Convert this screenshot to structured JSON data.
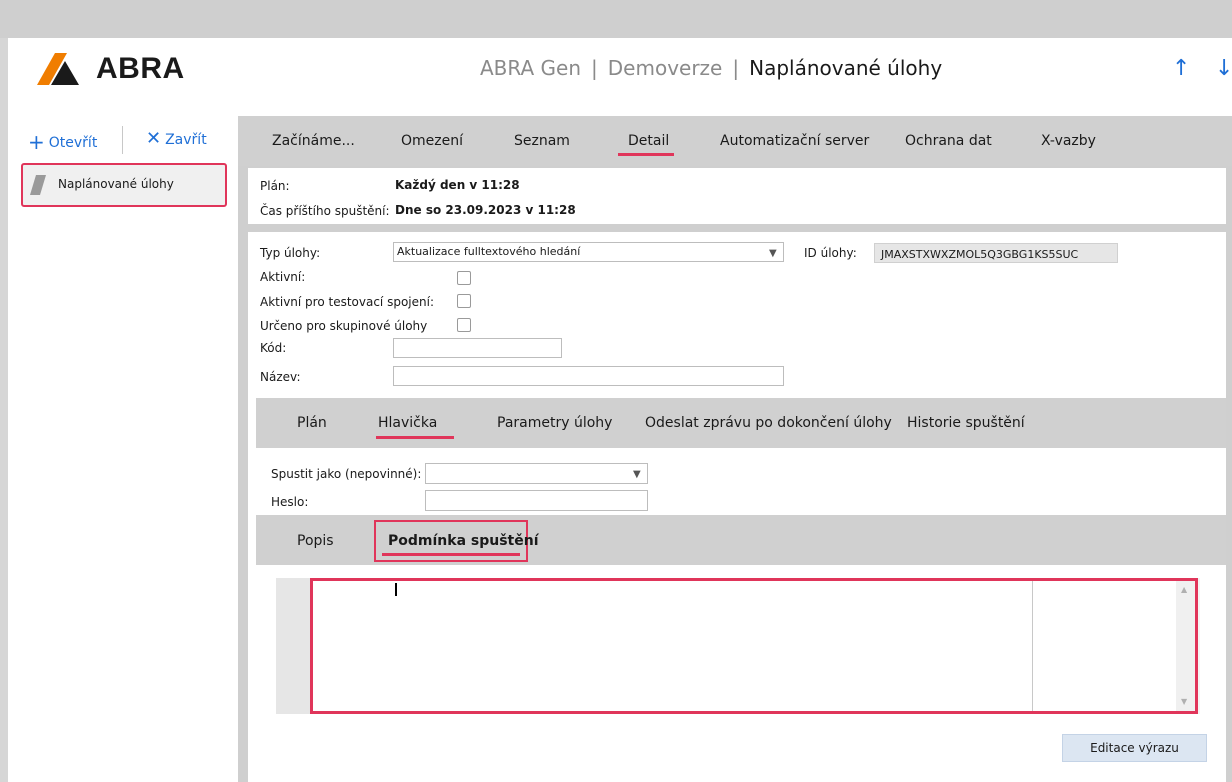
{
  "brand": {
    "logo_text": "ABRA"
  },
  "title": {
    "app": "ABRA Gen",
    "edition": "Demoverze",
    "module": "Naplánované úlohy"
  },
  "nav": {
    "up_icon": "arrow-up-icon",
    "down_icon": "arrow-down-icon"
  },
  "sidebar": {
    "open_label": "Otevřít",
    "close_label": "Zavřít",
    "items": [
      {
        "label": "Naplánované úlohy"
      }
    ]
  },
  "tabs": [
    {
      "label": "Začínáme..."
    },
    {
      "label": "Omezení"
    },
    {
      "label": "Seznam"
    },
    {
      "label": "Detail",
      "active": true
    },
    {
      "label": "Automatizační server"
    },
    {
      "label": "Ochrana dat"
    },
    {
      "label": "X-vazby"
    }
  ],
  "info": {
    "plan_label": "Plán:",
    "plan_value": "Každý den v 11:28",
    "next_label": "Čas příštího spuštění:",
    "next_value": "Dne so 23.09.2023 v 11:28"
  },
  "form": {
    "type_label": "Typ úlohy:",
    "type_value": "Aktualizace fulltextového hledání",
    "id_label": "ID úlohy:",
    "id_value": "JMAXSTXWXZMOL5Q3GBG1KS5SUC",
    "active_label": "Aktivní:",
    "active_test_label": "Aktivní pro testovací spojení:",
    "group_label": "Určeno pro skupinové úlohy",
    "code_label": "Kód:",
    "name_label": "Název:"
  },
  "subtabs": [
    {
      "label": "Plán"
    },
    {
      "label": "Hlavička",
      "active": true
    },
    {
      "label": "Parametry úlohy"
    },
    {
      "label": "Odeslat zprávu po dokončení úlohy"
    },
    {
      "label": "Historie spuštění"
    }
  ],
  "header_form": {
    "run_as_label": "Spustit jako (nepovinné):",
    "password_label": "Heslo:"
  },
  "desc_tabs": [
    {
      "label": "Popis"
    },
    {
      "label": "Podmínka spuštění",
      "active": true
    }
  ],
  "buttons": {
    "edit_expression": "Editace výrazu"
  },
  "colors": {
    "accent": "#e0355a",
    "link": "#1f6fd6"
  }
}
